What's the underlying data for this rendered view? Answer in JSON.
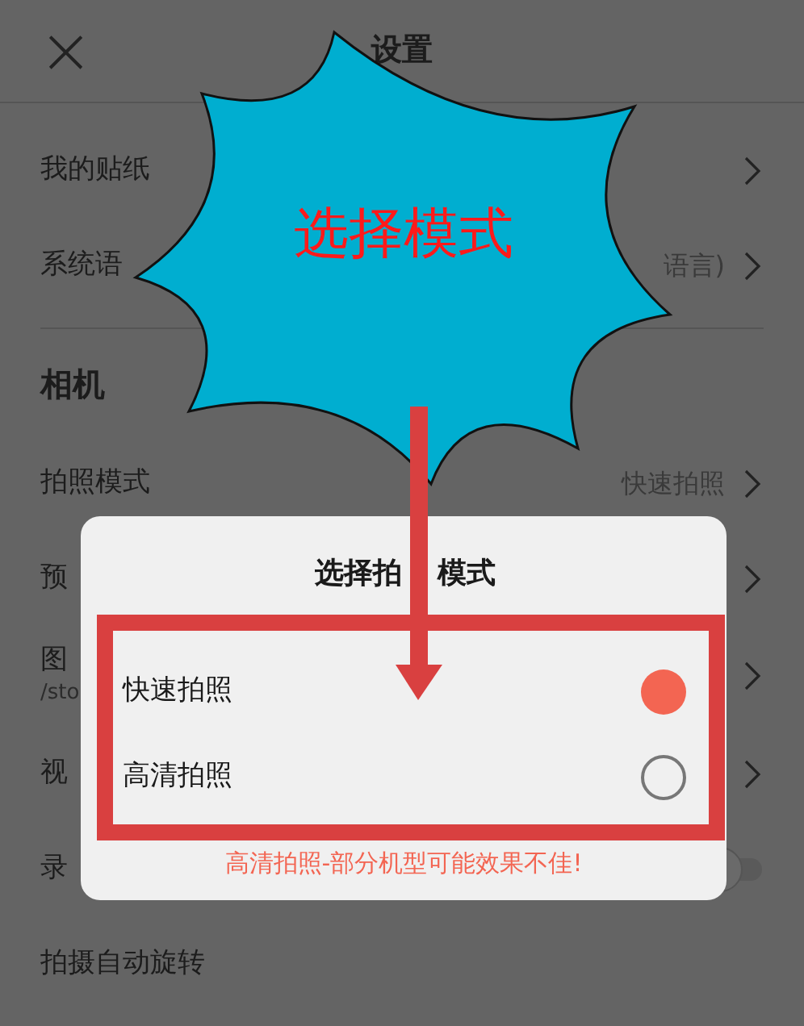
{
  "header": {
    "close_glyph": "×",
    "title": "设置"
  },
  "sections": [
    {
      "rows": [
        {
          "kind": "link",
          "label": "我的贴纸"
        },
        {
          "kind": "link",
          "label": "系统语",
          "value": "语言)"
        }
      ]
    },
    {
      "title": "相机",
      "rows": [
        {
          "kind": "link",
          "label": "拍照模式",
          "value": "快速拍照"
        },
        {
          "kind": "link",
          "label": "预"
        },
        {
          "kind": "path",
          "label": "图",
          "subtitle": "/sto"
        },
        {
          "kind": "link",
          "label": "视"
        },
        {
          "kind": "toggle",
          "label": "录",
          "on": false
        },
        {
          "kind": "plain",
          "label": "拍摄自动旋转"
        }
      ]
    }
  ],
  "dialog": {
    "title_parts": [
      "选择拍",
      "模式"
    ],
    "options": [
      {
        "label": "快速拍照",
        "selected": true
      },
      {
        "label": "高清拍照",
        "selected": false
      }
    ],
    "warning": "高清拍照-部分机型可能效果不佳!"
  },
  "callout": {
    "text": "选择模式"
  }
}
